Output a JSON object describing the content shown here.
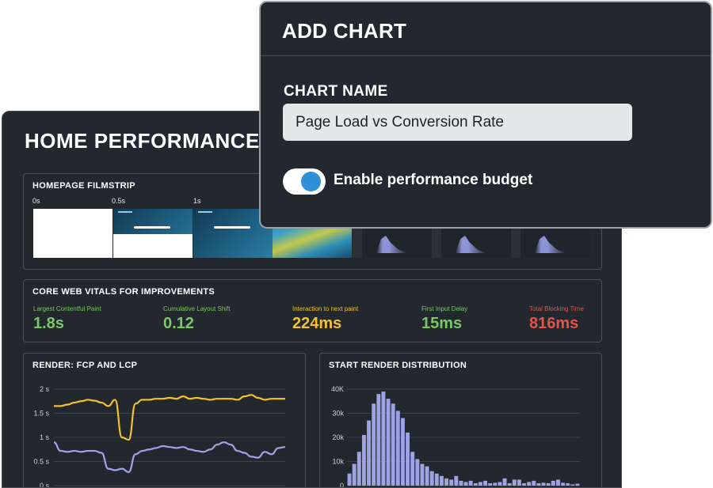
{
  "dashboard": {
    "title": "HOME PERFORMANCE"
  },
  "filmstrip": {
    "title": "HOMEPAGE FILMSTRIP",
    "times": [
      "0s",
      "0.5s",
      "1s"
    ]
  },
  "core_web_vitals": {
    "title": "CORE WEB VITALS FOR IMPROVEMENTS",
    "metrics": [
      {
        "label": "Largest Contentful Paint",
        "value": "1.8s",
        "color": "#7cc66a"
      },
      {
        "label": "Cumulative Layout Shift",
        "value": "0.12",
        "color": "#7cc66a"
      },
      {
        "label": "Interaction to next paint",
        "value": "224ms",
        "color": "#f2c230"
      },
      {
        "label": "First Input Delay",
        "value": "15ms",
        "color": "#7cc66a"
      },
      {
        "label": "Total Blocking Time",
        "value": "816ms",
        "color": "#e2544c"
      }
    ]
  },
  "render_chart": {
    "title": "RENDER: FCP AND LCP"
  },
  "distribution_chart": {
    "title": "START RENDER DISTRIBUTION"
  },
  "chart_data": [
    {
      "type": "line",
      "title": "RENDER: FCP AND LCP",
      "y_tick_labels": [
        "0 s",
        "0.5 s",
        "1 s",
        "1.5 s",
        "2 s"
      ],
      "ylim": [
        0,
        2
      ],
      "grid": true,
      "series": [
        {
          "color": "#f2c230",
          "values": [
            1.65,
            1.65,
            1.68,
            1.72,
            1.75,
            1.78,
            1.76,
            1.72,
            1.65,
            1.78,
            1.0,
            0.95,
            1.7,
            1.78,
            1.78,
            1.8,
            1.8,
            1.82,
            1.8,
            1.85,
            1.8,
            1.82,
            1.8,
            1.78,
            1.8,
            1.8,
            1.8,
            1.78,
            1.85,
            1.88,
            1.82,
            1.78,
            1.8,
            1.8,
            1.8
          ]
        },
        {
          "color": "#9ea3e6",
          "values": [
            0.9,
            0.72,
            0.7,
            0.72,
            0.7,
            0.72,
            0.72,
            0.68,
            0.35,
            0.32,
            0.35,
            0.28,
            0.65,
            0.72,
            0.75,
            0.78,
            0.82,
            0.8,
            0.78,
            0.8,
            0.75,
            0.72,
            0.7,
            0.75,
            0.85,
            0.9,
            0.85,
            0.72,
            0.68,
            0.6,
            0.58,
            0.7,
            0.65,
            0.78,
            0.8
          ]
        }
      ]
    },
    {
      "type": "bar",
      "title": "START RENDER DISTRIBUTION",
      "y_tick_labels": [
        "0",
        "10k",
        "20k",
        "30k",
        "40K"
      ],
      "ylim": [
        0,
        40000
      ],
      "grid": true,
      "color": "#9ea3e6",
      "values": [
        5000,
        9000,
        14000,
        21000,
        27000,
        34000,
        38000,
        39000,
        36000,
        34000,
        31000,
        28000,
        22000,
        14000,
        11000,
        9000,
        8000,
        6000,
        5000,
        4000,
        3000,
        2500,
        4000,
        2000,
        1500,
        2000,
        1000,
        1500,
        2000,
        1000,
        1200,
        1500,
        3000,
        1000,
        2500,
        2500,
        1000,
        1500,
        2000,
        1000,
        1200,
        1000,
        2000,
        2500,
        1200,
        1000,
        500,
        800
      ]
    }
  ],
  "modal": {
    "title": "ADD CHART",
    "name_label": "CHART NAME",
    "name_value": "Page Load vs Conversion Rate",
    "toggle_label": "Enable performance budget",
    "toggle_on": true
  }
}
